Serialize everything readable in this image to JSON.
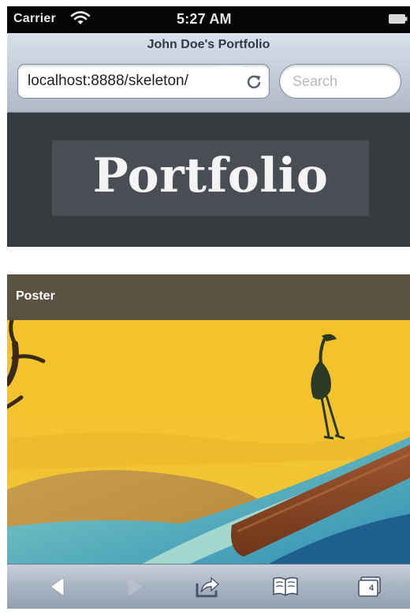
{
  "status_bar": {
    "carrier": "Carrier",
    "time": "5:27 AM",
    "icons": [
      "wifi-icon",
      "battery-icon"
    ]
  },
  "browser": {
    "page_title": "John Doe's Portfolio",
    "url": "localhost:8888/skeleton/",
    "search_placeholder": "Search",
    "icons": [
      "reload-icon"
    ]
  },
  "page": {
    "logo_text": "Portfolio",
    "section_label": "Poster",
    "colors": {
      "header_bg": "#373a3e",
      "logo_box_bg": "#4a4e54",
      "section_bar_bg": "#5b5242",
      "poster_sky": "#f2c12e"
    }
  },
  "toolbar": {
    "buttons": [
      {
        "name": "back",
        "icon": "back-arrow-icon",
        "enabled": true
      },
      {
        "name": "forward",
        "icon": "forward-arrow-icon",
        "enabled": false
      },
      {
        "name": "share",
        "icon": "share-icon",
        "enabled": true
      },
      {
        "name": "bookmarks",
        "icon": "bookmarks-book-icon",
        "enabled": true
      },
      {
        "name": "tabs",
        "icon": "tabs-icon",
        "enabled": true
      }
    ],
    "tabs_count": "4"
  }
}
